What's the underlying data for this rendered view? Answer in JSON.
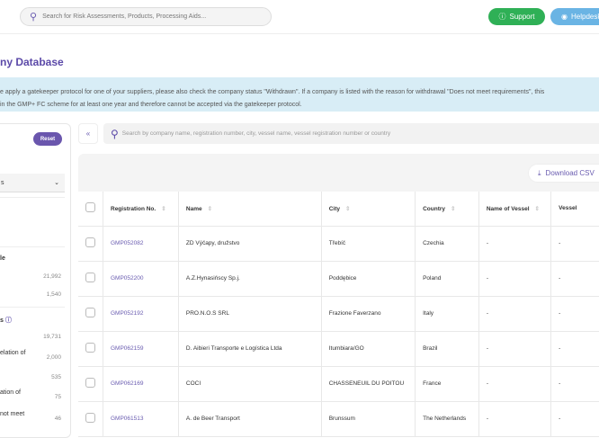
{
  "header": {
    "search_placeholder": "Search for Risk Assessments, Products, Processing Aids...",
    "support": "Support",
    "helpdesk": "Helpdesk"
  },
  "page_title": "ny Database",
  "notice": [
    "e apply a gatekeeper protocol for one of your suppliers, please also check the company status \"Withdrawn\". If a company is listed with the reason for withdrawal \"Does not meet requirements\", this",
    "in the GMP+ FC scheme for at least one year and therefore cannot be accepted via the gatekeeper protocol."
  ],
  "sidebar": {
    "reset": "Reset",
    "select_value": "s",
    "section1": "le",
    "counts1": [
      "21,992",
      "1,540"
    ],
    "section2": "s",
    "rows2": [
      {
        "label": "",
        "count": "19,731"
      },
      {
        "label": "elation of",
        "count": "2,000"
      },
      {
        "label": "",
        "count": "535"
      },
      {
        "label": "ation of",
        "count": "75"
      },
      {
        "label": "not meet",
        "count": "46"
      }
    ]
  },
  "table": {
    "collapse": "«",
    "search_placeholder": "Search by company name, registration number, city, vessel name, vessel registration number or country",
    "download": "Download CSV",
    "columns": [
      "Registration No.",
      "Name",
      "City",
      "Country",
      "Name of Vessel",
      "Vessel"
    ],
    "rows": [
      [
        "GMP052082",
        "ZD Výčapy, družstvo",
        "Třebíč",
        "Czechia",
        "-",
        "-"
      ],
      [
        "GMP052200",
        "A.Z.Hynasińscy Sp.j.",
        "Poddębice",
        "Poland",
        "-",
        "-"
      ],
      [
        "GMP052192",
        "PRO.N.O.S SRL",
        "Frazione Faverzano",
        "Italy",
        "-",
        "-"
      ],
      [
        "GMP062159",
        "D. Aibieri Transporte e Logística Ltda",
        "Itumbiara/GO",
        "Brazil",
        "-",
        "-"
      ],
      [
        "GMP062169",
        "COCI",
        "CHASSENEUIL DU POITOU",
        "France",
        "-",
        "-"
      ],
      [
        "GMP061513",
        "A. de Beer Transport",
        "Brunssum",
        "The Netherlands",
        "-",
        "-"
      ]
    ]
  }
}
